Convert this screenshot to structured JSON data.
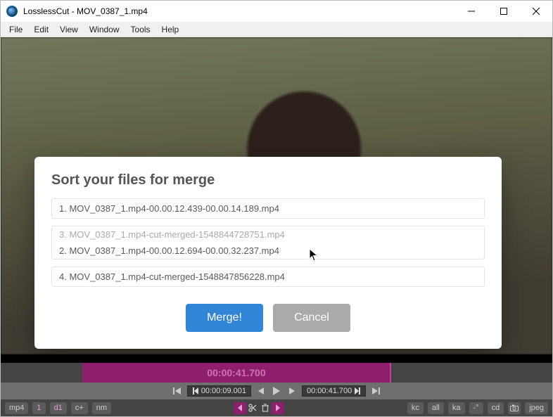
{
  "window": {
    "title": "LosslessCut - MOV_0387_1.mp4"
  },
  "menu": {
    "file": "File",
    "edit": "Edit",
    "view": "View",
    "window": "Window",
    "tools": "Tools",
    "help": "Help"
  },
  "modal": {
    "heading": "Sort your files for merge",
    "item1": "1. MOV_0387_1.mp4-00.00.12.439-00.00.14.189.mp4",
    "item3_dragging": "3. MOV_0387_1.mp4-cut-merged-1548844728751.mp4",
    "item2": "2. MOV_0387_1.mp4-00.00.12.694-00.00.32.237.mp4",
    "item4": "4. MOV_0387_1.mp4-cut-merged-1548847856228.mp4",
    "merge": "Merge!",
    "cancel": "Cancel"
  },
  "timeline": {
    "segment_time": "00:00:41.700"
  },
  "controls": {
    "start_time": "00:00:09.001",
    "end_time": "00:00:41.700"
  },
  "bottom": {
    "left": {
      "format": "mp4",
      "seg": "1",
      "d1": "d1",
      "cplus": "c+",
      "nm": "nm"
    },
    "right": {
      "kc": "kc",
      "all": "all",
      "ka": "ka",
      "dash": "-°",
      "cd": "cd",
      "jpeg": "jpeg"
    }
  }
}
